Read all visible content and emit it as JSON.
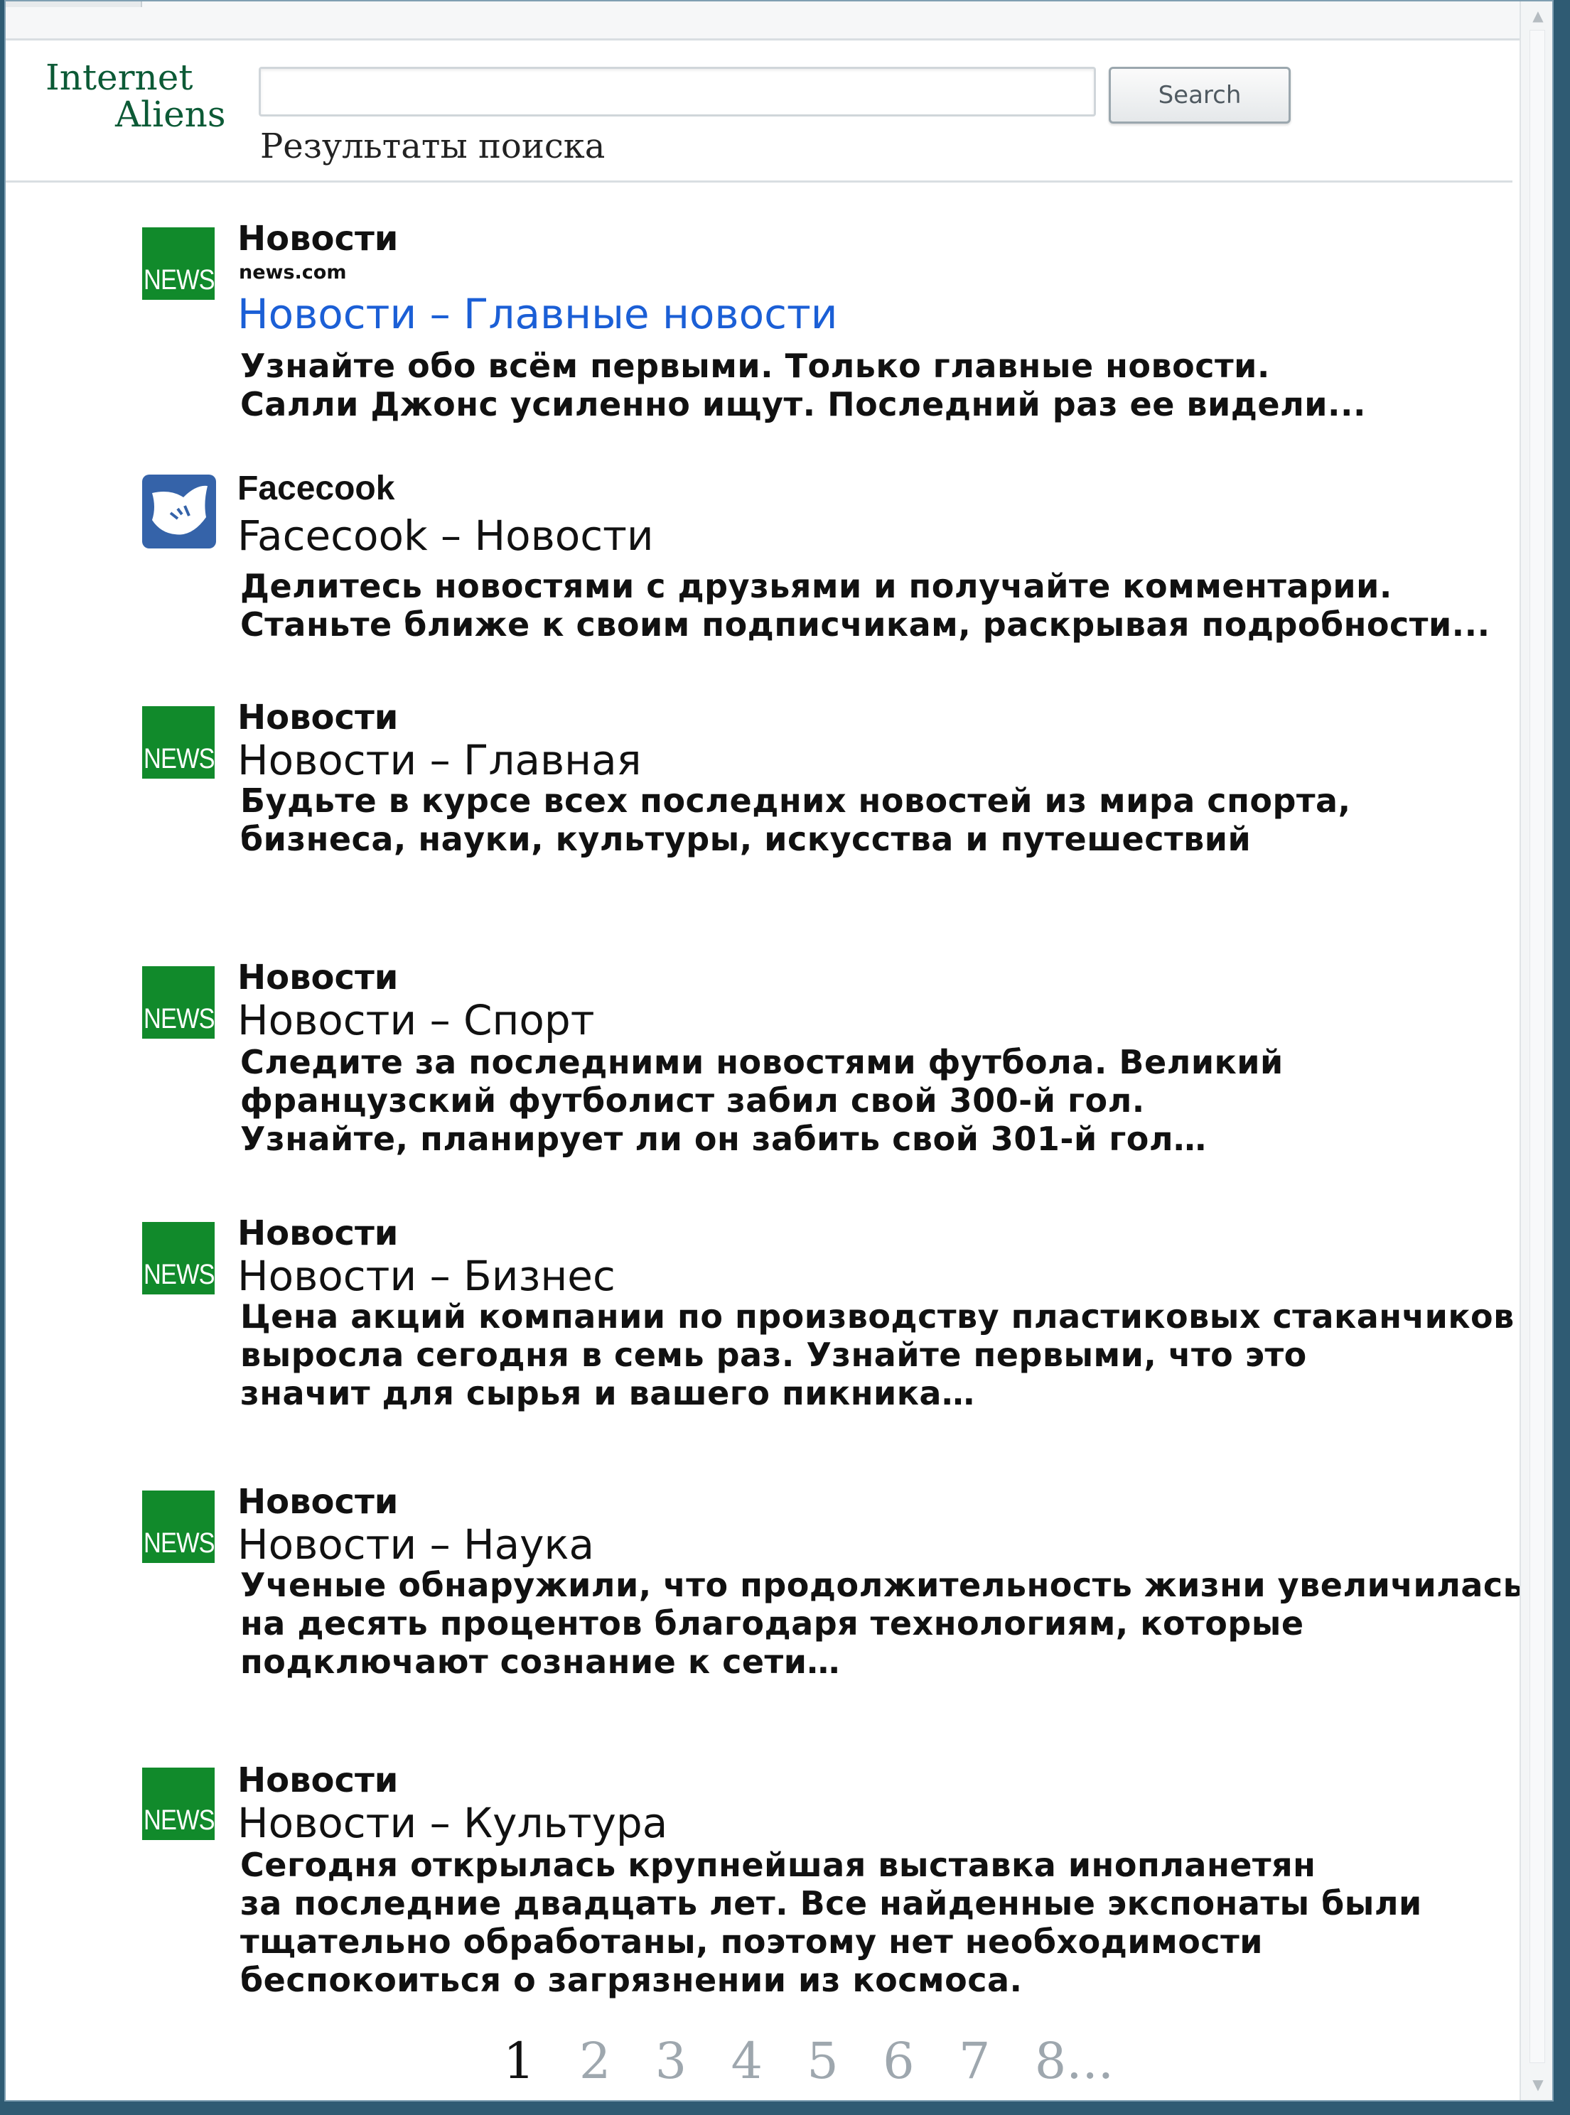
{
  "logo": {
    "line1": "Internet",
    "line2": "Aliens"
  },
  "search": {
    "value": "",
    "button_label": "Search"
  },
  "results_heading": "Результаты поиска",
  "results": [
    {
      "icon": "news-icon",
      "icon_text": "NEWS",
      "source": "Новости",
      "domain": "news.com",
      "title": "Новости – Главные новости",
      "snippet": "Узнайте обо всём первыми. Только главные новости.\nСалли Джонс усиленно ищут. Последний раз ее видели..."
    },
    {
      "icon": "facecook-icon",
      "source": "Facecook",
      "title": "Facecook – Новости",
      "snippet": "Делитесь новостями с друзьями и получайте комментарии.\nСтаньте ближе к своим подписчикам, раскрывая подробности..."
    },
    {
      "icon": "news-icon",
      "icon_text": "NEWS",
      "source": "Новости",
      "title": "Новости – Главная",
      "snippet": "Будьте в курсе всех последних новостей из мира спорта,\nбизнеса, науки, культуры, искусства и путешествий"
    },
    {
      "icon": "news-icon",
      "icon_text": "NEWS",
      "source": "Новости",
      "title": "Новости – Спорт",
      "snippet": "Следите за последними новостями футбола. Великий\nфранцузский футболист забил свой 300-й гол.\nУзнайте, планирует ли он забить свой 301-й гол…"
    },
    {
      "icon": "news-icon",
      "icon_text": "NEWS",
      "source": "Новости",
      "title": "Новости – Бизнес",
      "snippet": "Цена акций компании по производству пластиковых стаканчиков\nвыросла сегодня в семь раз. Узнайте первыми, что это\nзначит для сырья и вашего пикника…"
    },
    {
      "icon": "news-icon",
      "icon_text": "NEWS",
      "source": "Новости",
      "title": "Новости – Наука",
      "snippet": "Ученые обнаружили, что продолжительность жизни увеличилась\nна десять процентов благодаря технологиям, которые\nподключают сознание к сети…"
    },
    {
      "icon": "news-icon",
      "icon_text": "NEWS",
      "source": "Новости",
      "title": "Новости – Культура",
      "snippet": "Сегодня открылась крупнейшая выставка инопланетян\nза последние двадцать лет. Все найденные экспонаты были\nтщательно обработаны, поэтому нет необходимости\nбеспокоиться о загрязнении из космоса."
    }
  ],
  "pagination": {
    "pages": [
      "1",
      "2",
      "3",
      "4",
      "5",
      "6",
      "7",
      "8..."
    ],
    "current": "1"
  }
}
